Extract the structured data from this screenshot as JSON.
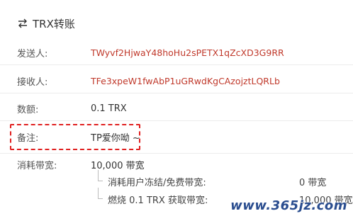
{
  "header": {
    "title": "TRX转账",
    "icon": "transfer-arrows-icon"
  },
  "fields": {
    "sender": {
      "label": "发送人:",
      "value": "TWyvf2HjwaY48hoHu2sPETX1qZcXD3G9RR"
    },
    "receiver": {
      "label": "接收人:",
      "value": "TFe3xpeW1fwAbP1uGRwdKgCAzojztLQRLb"
    },
    "amount": {
      "label": "数额:",
      "value": "0.1 TRX"
    },
    "memo": {
      "label": "备注:",
      "value": "TP爱你呦 ~"
    },
    "bandwidth": {
      "label": "消耗带宽:",
      "value": "10,000 带宽"
    }
  },
  "bandwidth_details": [
    {
      "label": "消耗用户冻结/免费带宽:",
      "value": "0 带宽"
    },
    {
      "label": "燃烧 0.1 TRX 获取带宽:",
      "value": "10,000 带宽"
    }
  ],
  "watermark": "www.365jz.com",
  "colors": {
    "address": "#c0392b",
    "highlight_border": "#e02020",
    "watermark": "#2a4d8f"
  }
}
